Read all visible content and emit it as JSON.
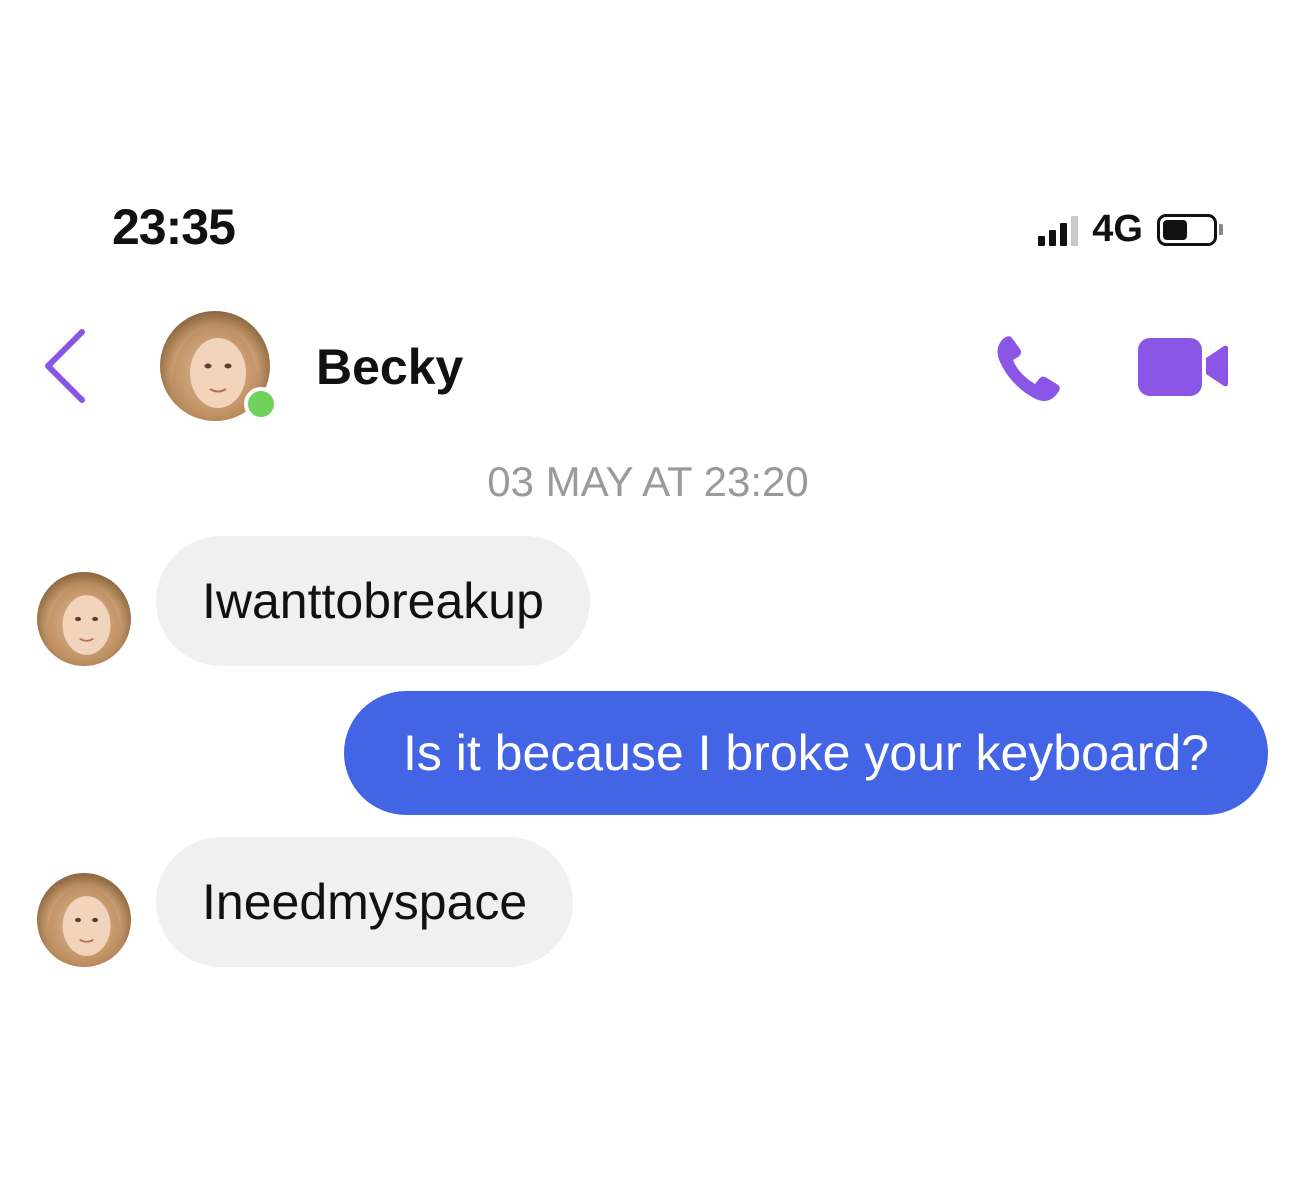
{
  "status_bar": {
    "time": "23:35",
    "network": "4G",
    "battery_level": 0.5,
    "signal_icon": "signal-bars-icon",
    "battery_icon": "battery-icon"
  },
  "header": {
    "contact_name": "Becky",
    "online": true,
    "back_icon": "chevron-left-icon",
    "call_icon": "phone-icon",
    "video_icon": "video-camera-icon",
    "accent_color": "#8b55e6"
  },
  "conversation": {
    "timestamp": "03 MAY AT 23:20",
    "messages": [
      {
        "direction": "incoming",
        "text": "Iwanttobreakup"
      },
      {
        "direction": "outgoing",
        "text": "Is it because I broke your keyboard?"
      },
      {
        "direction": "incoming",
        "text": "Ineedmyspace"
      }
    ]
  },
  "colors": {
    "incoming_bubble": "#f0f0f0",
    "outgoing_bubble": "#4464e6",
    "online_indicator": "#6fd25a"
  }
}
